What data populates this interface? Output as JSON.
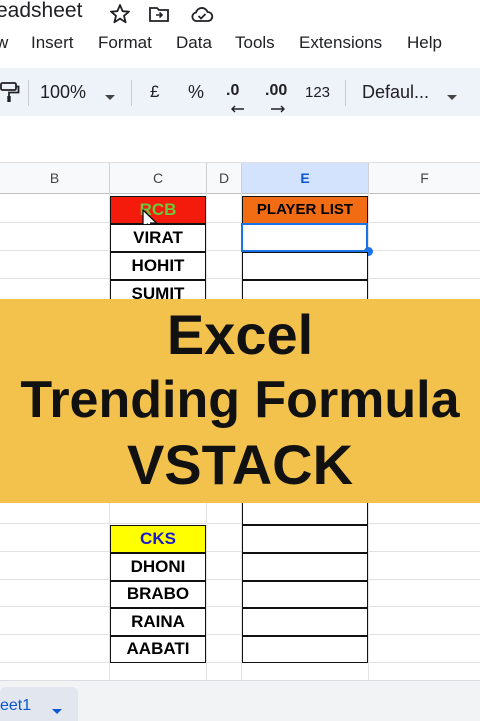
{
  "title_bar": {
    "doc_title_partial": "eadsheet"
  },
  "menu": [
    "w",
    "Insert",
    "Format",
    "Data",
    "Tools",
    "Extensions",
    "Help"
  ],
  "toolbar": {
    "zoom": "100%",
    "currency": "£",
    "percent": "%",
    "decrease_decimal": ".0",
    "increase_decimal": ".00",
    "number_format": "123",
    "font": "Defaul..."
  },
  "columns": [
    "B",
    "C",
    "D",
    "E",
    "F"
  ],
  "selected_column": "E",
  "cells": {
    "rcb_header": "RCB",
    "rcb_players": [
      "VIRAT",
      "HOHIT",
      "SUMIT"
    ],
    "player_list_header": "PLAYER LIST",
    "cks_header": "CKS",
    "cks_players": [
      "DHONI",
      "BRABO",
      "RAINA",
      "AABATI"
    ]
  },
  "banner": {
    "lines": [
      "Excel",
      "Trending Formula",
      "VSTACK"
    ]
  },
  "sheet_tab": {
    "label": "eet1"
  },
  "colors": {
    "rcb_fill": "#f41b0c",
    "rcb_text": "#6ac83c",
    "player_list_fill": "#f26c14",
    "cks_fill": "#ffff00",
    "cks_text": "#1b1ad1",
    "banner_bg": "#f3c24d",
    "selection": "#1a73e8"
  }
}
